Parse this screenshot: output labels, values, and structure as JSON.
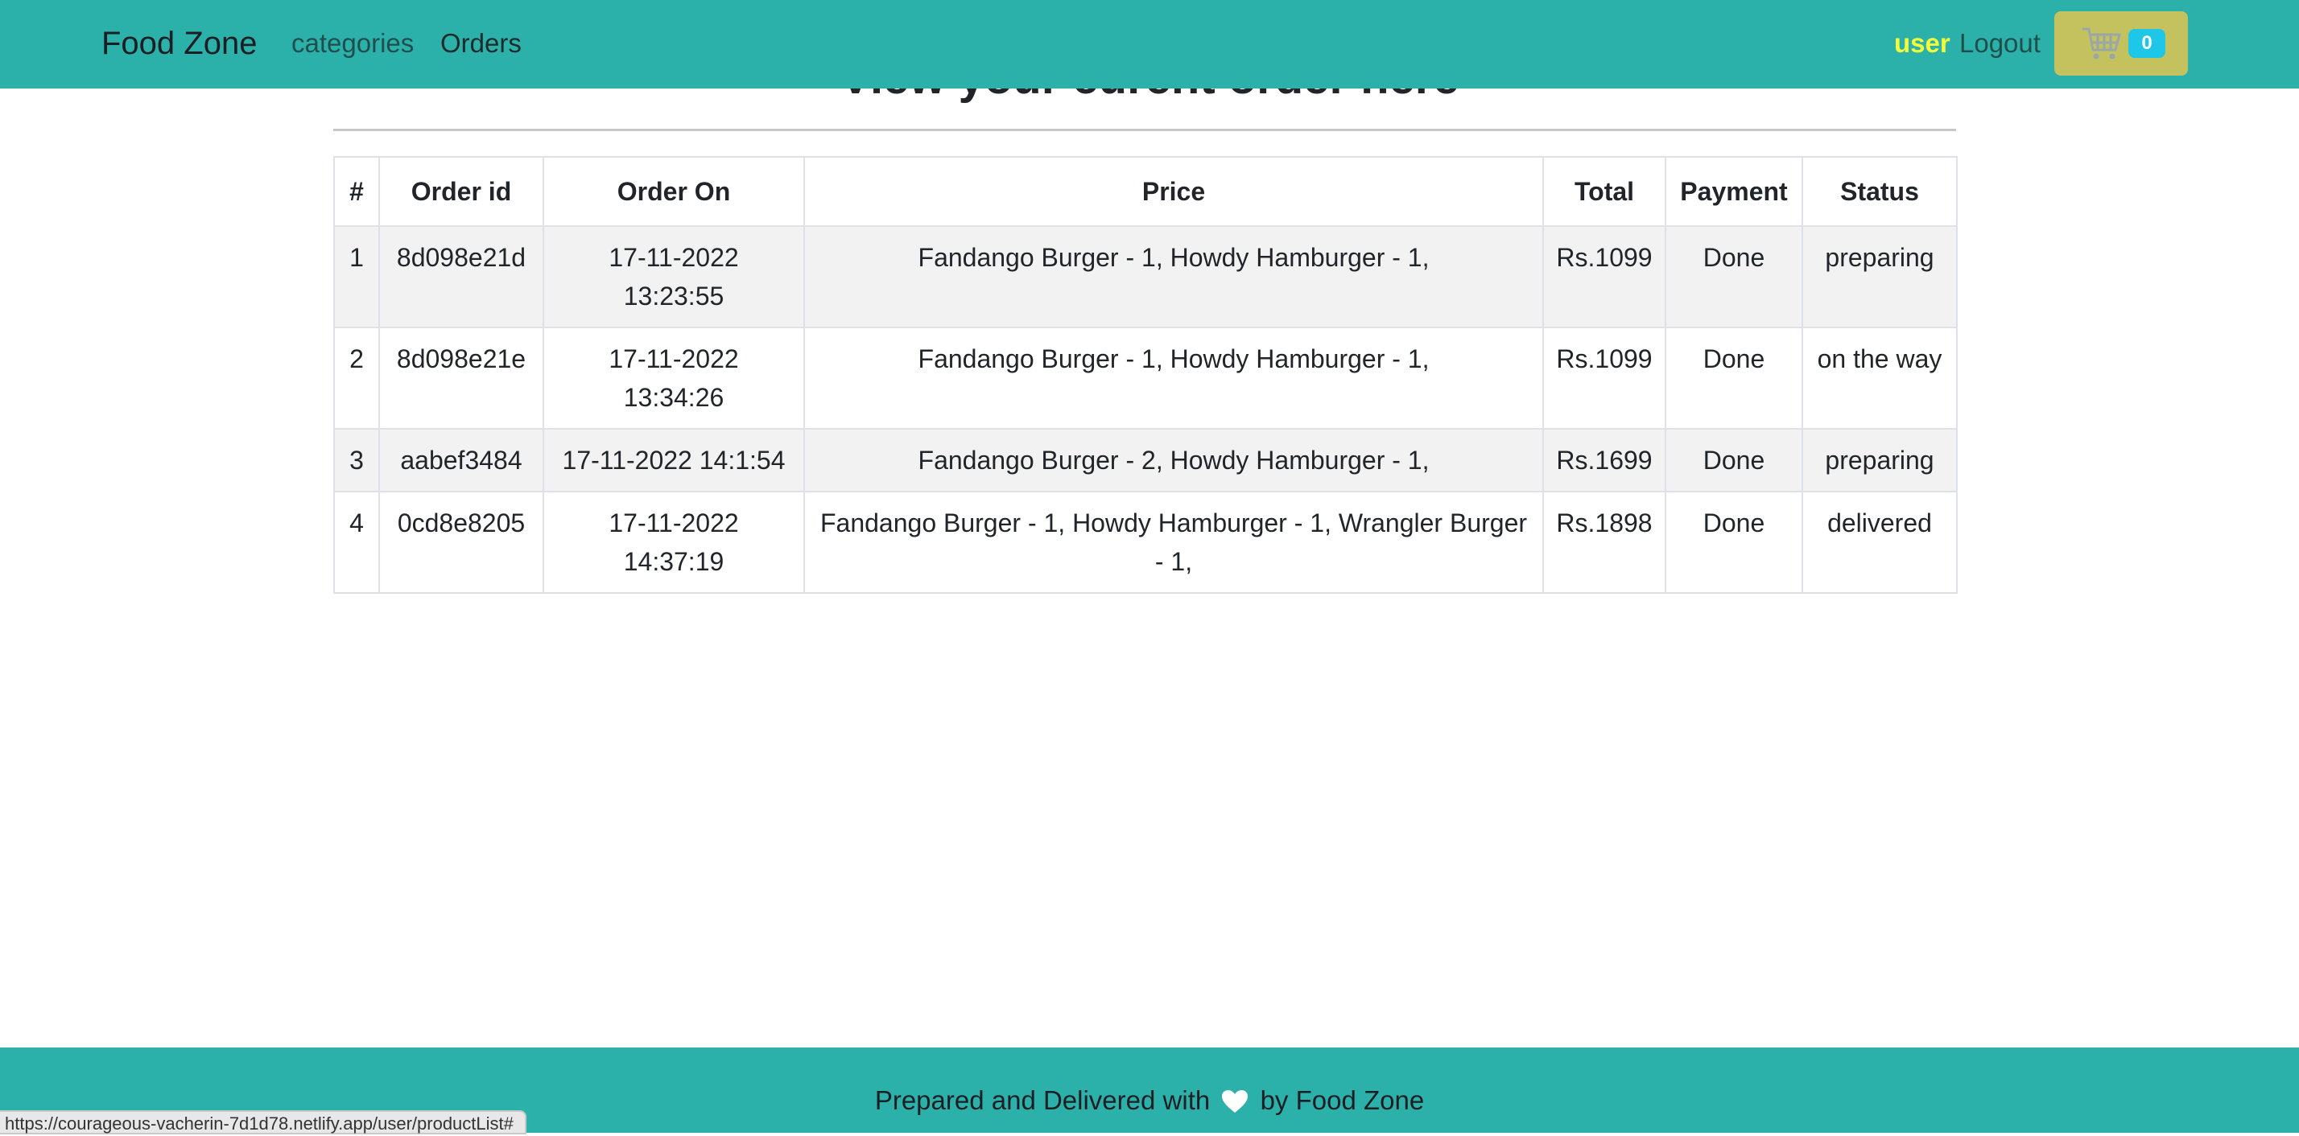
{
  "page": {
    "heading": "View your curent order here"
  },
  "navbar": {
    "brand": "Food Zone",
    "links": [
      "categories",
      "Orders"
    ],
    "username": "user",
    "logout": "Logout",
    "cart_count": "0",
    "cart_icon": "cart-icon"
  },
  "orders": {
    "columns": [
      "#",
      "Order id",
      "Order On",
      "Price",
      "Total",
      "Payment",
      "Status"
    ],
    "rows": [
      [
        "1",
        "8d098e21d",
        "17-11-2022 13:23:55",
        "Fandango Burger - 1, Howdy Hamburger - 1,",
        "Rs.1099",
        "Done",
        "preparing"
      ],
      [
        "2",
        "8d098e21e",
        "17-11-2022 13:34:26",
        "Fandango Burger - 1, Howdy Hamburger - 1,",
        "Rs.1099",
        "Done",
        "on the way"
      ],
      [
        "3",
        "aabef3484",
        "17-11-2022 14:1:54",
        "Fandango Burger - 2, Howdy Hamburger - 1,",
        "Rs.1699",
        "Done",
        "preparing"
      ],
      [
        "4",
        "0cd8e8205",
        "17-11-2022 14:37:19",
        "Fandango Burger - 1, Howdy Hamburger - 1, Wrangler Burger - 1,",
        "Rs.1898",
        "Done",
        "delivered"
      ]
    ]
  },
  "footer": {
    "text_before": "Prepared and Delivered with",
    "text_after": "by Food Zone",
    "icon": "heart-icon"
  },
  "status_bar": {
    "url": "https://courageous-vacherin-7d1d78.netlify.app/user/productList#"
  },
  "colors": {
    "navbar": "#2cb1aa",
    "cart_button": "#c4c15f",
    "cart_badge": "#1ec7e8",
    "username": "#f2ff3a"
  }
}
